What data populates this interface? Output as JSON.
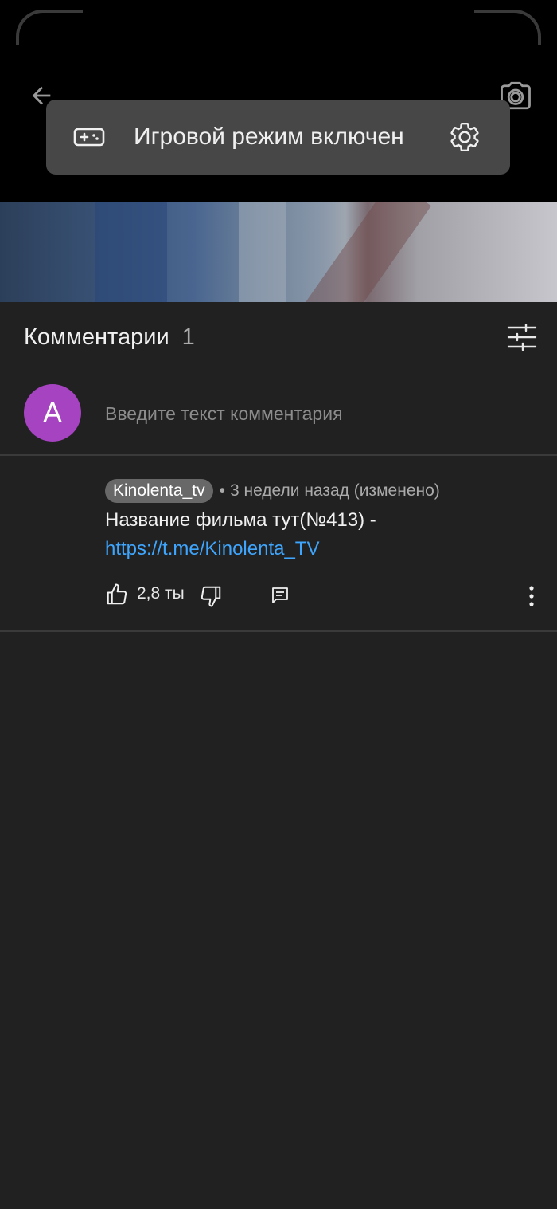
{
  "header": {
    "back_icon": "arrow-back-icon",
    "camera_icon": "camera-icon"
  },
  "toast": {
    "icon": "gamepad-icon",
    "text": "Игровой режим включен",
    "settings_icon": "gear-icon"
  },
  "comments": {
    "title": "Комментарии",
    "count": "1",
    "filter_icon": "sliders-icon",
    "input": {
      "avatar_letter": "A",
      "avatar_color": "#a543c0",
      "placeholder": "Введите текст комментария",
      "value": ""
    },
    "items": [
      {
        "author": "Kinolenta_tv",
        "separator": "•",
        "time": "3 недели назад (изменено)",
        "text_prefix": "Название фильма тут(№413) -",
        "link_text": "https://t.me/Kinolenta_TV",
        "likes": "2,8 ты",
        "link_color": "#3ea6ff"
      }
    ]
  },
  "colors": {
    "panel_bg": "#212121",
    "toast_bg": "#474747",
    "accent_link": "#3ea6ff"
  }
}
